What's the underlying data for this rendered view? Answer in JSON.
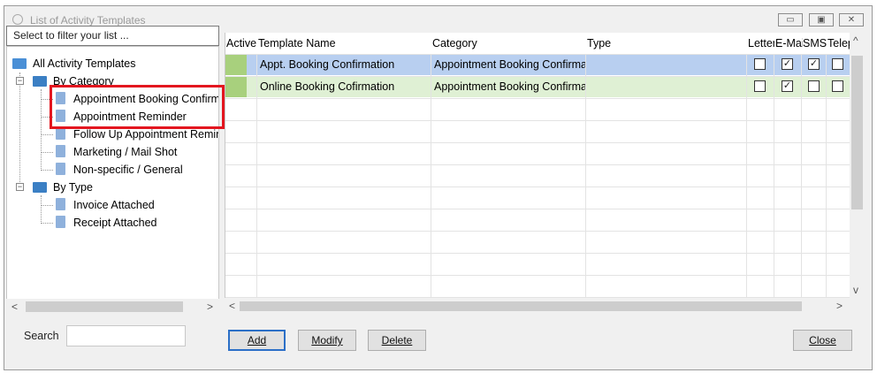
{
  "window": {
    "title": "List of Activity Templates",
    "minimize": "▭",
    "restore": "▣",
    "close": "✕"
  },
  "filter": {
    "placeholder": "Select to filter your list ..."
  },
  "tree": {
    "root": "All Activity Templates",
    "by_category": "By Category",
    "category_items": [
      "Appointment Booking Confirmation",
      "Appointment Reminder",
      "Follow Up Appointment Reminder",
      "Marketing / Mail Shot",
      "Non-specific / General"
    ],
    "by_type": "By Type",
    "type_items": [
      "Invoice Attached",
      "Receipt Attached"
    ],
    "expander_open": "−"
  },
  "search": {
    "label": "Search",
    "value": ""
  },
  "grid": {
    "columns": [
      "Active",
      "Template Name",
      "Category",
      "Type",
      "Letter",
      "E-Mail",
      "SMS",
      "Telephone"
    ],
    "rows": [
      {
        "name": "Appt. Booking Confirmation",
        "category": "Appointment Booking Confirmation",
        "type": "",
        "letter": "",
        "email": "✓",
        "sms": "✓",
        "telephone": ""
      },
      {
        "name": "Online Booking Cofirmation",
        "category": "Appointment Booking Confirmation",
        "type": "",
        "letter": "",
        "email": "✓",
        "sms": "",
        "telephone": ""
      }
    ]
  },
  "buttons": {
    "add": "Add",
    "modify": "Modify",
    "delete": "Delete",
    "close": "Close"
  },
  "arrows": {
    "left": "<",
    "right": ">",
    "up": "^",
    "down": "v"
  },
  "colors": {
    "row_selected": "#b8cff0",
    "row_alt": "#dff0d4",
    "active_marker": "#a8d07d",
    "highlight_box": "#e3161f"
  }
}
